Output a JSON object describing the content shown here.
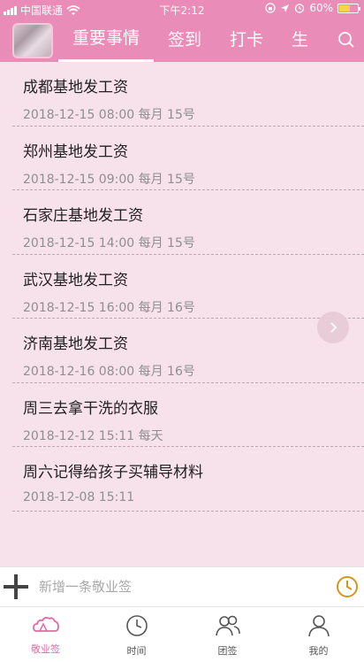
{
  "status_bar": {
    "carrier": "中国联通",
    "time": "下午2:12",
    "battery_percent_label": "60%",
    "battery_level": 0.6
  },
  "header": {
    "tabs": [
      {
        "label": "重要事情",
        "active": true
      },
      {
        "label": "签到",
        "active": false
      },
      {
        "label": "打卡",
        "active": false
      },
      {
        "label": "生",
        "active": false
      }
    ]
  },
  "items": [
    {
      "title": "成都基地发工资",
      "meta": "2018-12-15 08:00 每月 15号"
    },
    {
      "title": "郑州基地发工资",
      "meta": "2018-12-15 09:00 每月 15号"
    },
    {
      "title": "石家庄基地发工资",
      "meta": "2018-12-15 14:00 每月 15号"
    },
    {
      "title": "武汉基地发工资",
      "meta": "2018-12-15 16:00 每月 16号"
    },
    {
      "title": "济南基地发工资",
      "meta": "2018-12-16 08:00 每月 16号"
    },
    {
      "title": "周三去拿干洗的衣服",
      "meta": "2018-12-12 15:11 每天"
    },
    {
      "title": "周六记得给孩子买辅导材料",
      "meta": "2018-12-08 15:11"
    }
  ],
  "input": {
    "placeholder": "新增一条敬业签"
  },
  "bottom_nav": [
    {
      "label": "敬业签",
      "icon": "cloud-icon",
      "active": true
    },
    {
      "label": "时间",
      "icon": "clock-icon",
      "active": false
    },
    {
      "label": "团签",
      "icon": "team-icon",
      "active": false
    },
    {
      "label": "我的",
      "icon": "person-icon",
      "active": false
    }
  ],
  "colors": {
    "accent": "#e98cb7",
    "background": "#f7e1ea",
    "active_nav": "#e46aa3",
    "clock_icon": "#d4951c"
  }
}
